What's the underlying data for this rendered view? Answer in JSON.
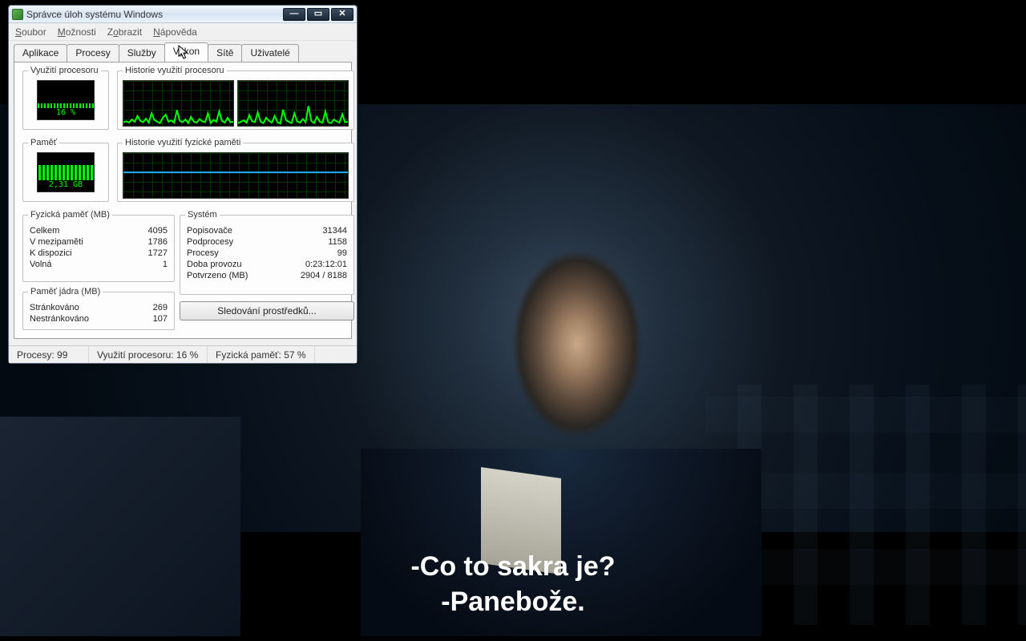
{
  "subtitle": {
    "line1": "-Co to sakra je?",
    "line2": "-Panebože."
  },
  "window": {
    "title": "Správce úloh systému Windows"
  },
  "menu": {
    "file": "Soubor",
    "options": "Možnosti",
    "view": "Zobrazit",
    "help": "Nápověda"
  },
  "tabs": {
    "apps": "Aplikace",
    "procs": "Procesy",
    "svcs": "Služby",
    "perf": "Výkon",
    "net": "Sítě",
    "users": "Uživatelé"
  },
  "groups": {
    "cpu": "Využití procesoru",
    "cpu_hist": "Historie využití procesoru",
    "mem": "Paměť",
    "mem_hist": "Historie využití fyzické paměti",
    "phys": "Fyzická paměť (MB)",
    "sys": "Systém",
    "kern": "Paměť jádra (MB)"
  },
  "gauges": {
    "cpu_pct": "16 %",
    "mem_val": "2,31 GB"
  },
  "phys": {
    "total_l": "Celkem",
    "total_v": "4095",
    "cache_l": "V mezipaměti",
    "cache_v": "1786",
    "avail_l": "K dispozici",
    "avail_v": "1727",
    "free_l": "Volná",
    "free_v": "1"
  },
  "sys": {
    "handles_l": "Popisovače",
    "handles_v": "31344",
    "threads_l": "Podprocesy",
    "threads_v": "1158",
    "procs_l": "Procesy",
    "procs_v": "99",
    "uptime_l": "Doba provozu",
    "uptime_v": "0:23:12:01",
    "commit_l": "Potvrzeno (MB)",
    "commit_v": "2904 / 8188"
  },
  "kern": {
    "paged_l": "Stránkováno",
    "paged_v": "269",
    "nonpaged_l": "Nestránkováno",
    "nonpaged_v": "107"
  },
  "buttons": {
    "resmon": "Sledování prostředků..."
  },
  "status": {
    "procs": "Procesy: 99",
    "cpu": "Využití procesoru: 16 %",
    "mem": "Fyzická paměť: 57 %"
  },
  "chart_data": [
    {
      "type": "gauge",
      "name": "cpu_usage",
      "value": 16,
      "unit": "%",
      "range": [
        0,
        100
      ]
    },
    {
      "type": "gauge",
      "name": "mem_usage",
      "value": 2.31,
      "unit": "GB",
      "percent": 57,
      "range_mb": [
        0,
        4095
      ]
    },
    {
      "type": "line",
      "name": "cpu_history_core0",
      "ylim": [
        0,
        100
      ],
      "values": [
        8,
        10,
        7,
        14,
        9,
        22,
        11,
        8,
        16,
        7,
        28,
        13,
        9,
        6,
        18,
        25,
        9,
        12,
        7,
        35,
        11,
        8,
        14,
        6,
        20,
        9,
        7,
        15,
        10,
        8,
        28,
        6,
        13,
        9,
        32,
        11,
        7,
        18,
        8,
        9
      ]
    },
    {
      "type": "line",
      "name": "cpu_history_core1",
      "ylim": [
        0,
        100
      ],
      "values": [
        6,
        9,
        12,
        7,
        24,
        10,
        8,
        30,
        9,
        6,
        18,
        11,
        7,
        22,
        8,
        5,
        36,
        13,
        9,
        6,
        28,
        10,
        7,
        15,
        8,
        44,
        11,
        6,
        20,
        9,
        7,
        32,
        8,
        6,
        14,
        10,
        7,
        26,
        8,
        9
      ]
    },
    {
      "type": "line",
      "name": "mem_history_percent",
      "ylim": [
        0,
        100
      ],
      "values": [
        57,
        57,
        57,
        57,
        57,
        57,
        57,
        57,
        57,
        57,
        57,
        57,
        57,
        57,
        57,
        57,
        57,
        57,
        57,
        57,
        57,
        57,
        57,
        57,
        57,
        57,
        57,
        57,
        57,
        57
      ]
    }
  ]
}
